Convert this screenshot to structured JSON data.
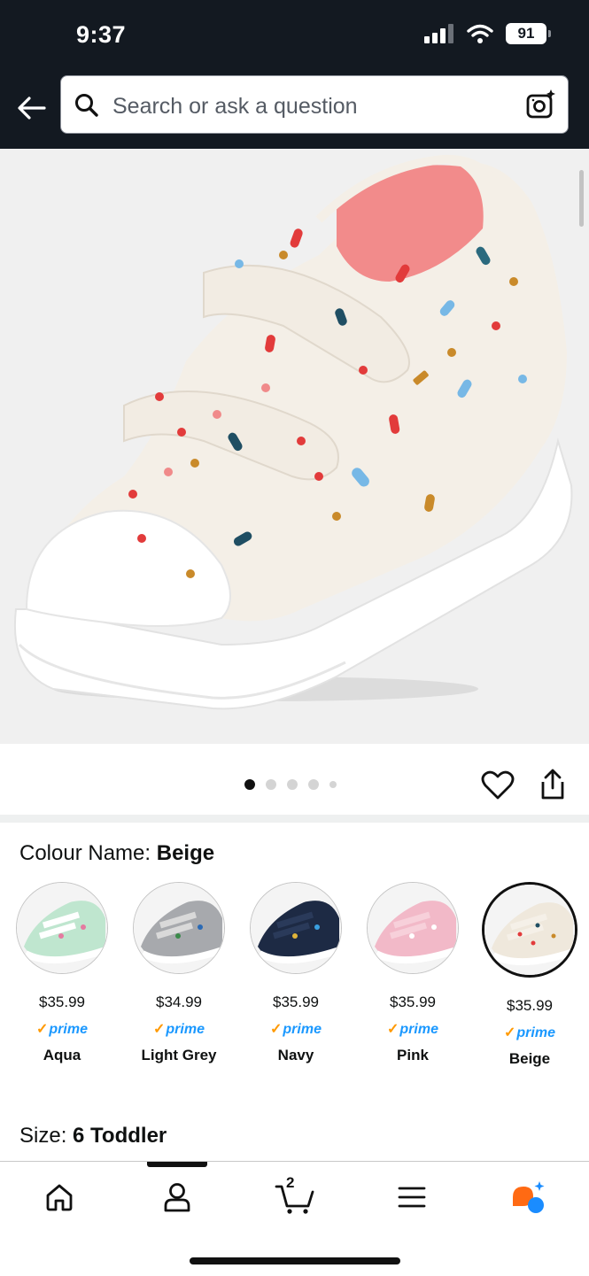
{
  "status": {
    "time": "9:37",
    "battery": "91"
  },
  "search": {
    "placeholder": "Search or ask a question"
  },
  "product": {
    "colour_label": "Colour Name:",
    "colour_value": "Beige",
    "size_label": "Size:",
    "size_value": "6 Toddler"
  },
  "colors": {
    "topbar": "#131921",
    "prime": "#1a98ff",
    "prime_check": "#ff9900"
  },
  "variants": [
    {
      "price": "$35.99",
      "prime": "prime",
      "name": "Aqua",
      "selected": false
    },
    {
      "price": "$34.99",
      "prime": "prime",
      "name": "Light Grey",
      "selected": false
    },
    {
      "price": "$35.99",
      "prime": "prime",
      "name": "Navy",
      "selected": false
    },
    {
      "price": "$35.99",
      "prime": "prime",
      "name": "Pink",
      "selected": false
    },
    {
      "price": "$35.99",
      "prime": "prime",
      "name": "Beige",
      "selected": true
    }
  ],
  "carousel": {
    "total": 5,
    "active": 1
  },
  "nav": {
    "items": [
      "home-icon",
      "account-icon",
      "cart-icon",
      "menu-icon",
      "rufus-icon"
    ],
    "cart_count": "2"
  }
}
